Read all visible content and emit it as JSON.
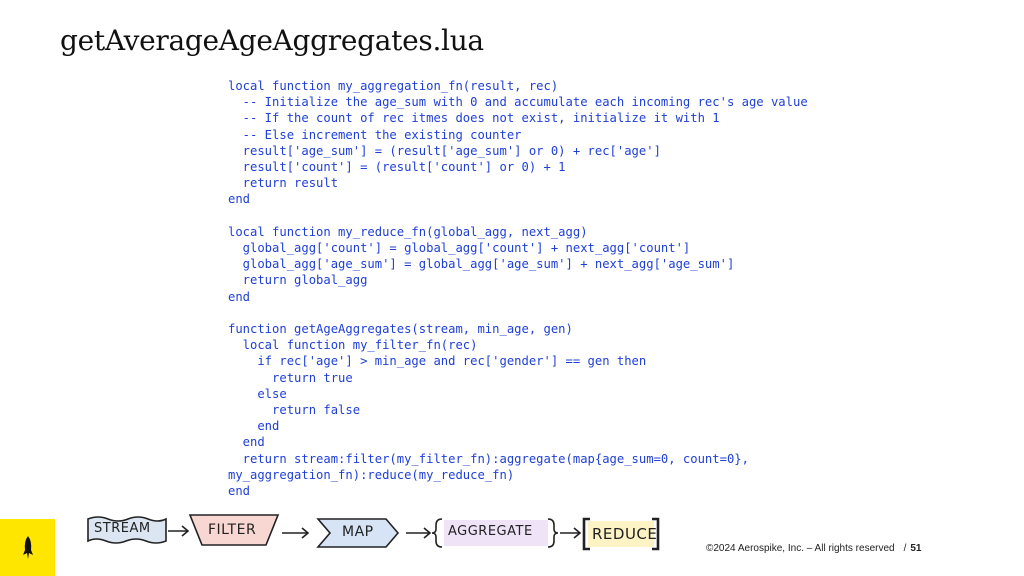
{
  "slide": {
    "title": "getAverageAgeAggregates.lua",
    "code": "local function my_aggregation_fn(result, rec)\n  -- Initialize the age_sum with 0 and accumulate each incoming rec's age value\n  -- If the count of rec itmes does not exist, initialize it with 1\n  -- Else increment the existing counter\n  result['age_sum'] = (result['age_sum'] or 0) + rec['age']\n  result['count'] = (result['count'] or 0) + 1\n  return result\nend\n\nlocal function my_reduce_fn(global_agg, next_agg)\n  global_agg['count'] = global_agg['count'] + next_agg['count']\n  global_agg['age_sum'] = global_agg['age_sum'] + next_agg['age_sum']\n  return global_agg\nend\n\nfunction getAgeAggregates(stream, min_age, gen)\n  local function my_filter_fn(rec)\n    if rec['age'] > min_age and rec['gender'] == gen then\n      return true\n    else\n      return false\n    end\n  end\n  return stream:filter(my_filter_fn):aggregate(map{age_sum=0, count=0},\nmy_aggregation_fn):reduce(my_reduce_fn)\nend",
    "code_color": "#1f3fd6"
  },
  "pipeline": {
    "stream": "STREAM",
    "filter": "FILTER",
    "map": "MAP",
    "aggregate": "AGGREGATE",
    "reduce": "REDUCE"
  },
  "footer": {
    "copyright": "©2024 Aerospike, Inc. – All rights reserved",
    "separator": "/",
    "page_number": "51"
  },
  "brand": {
    "logo_icon": "rocket-icon",
    "logo_bg": "#ffe600"
  }
}
